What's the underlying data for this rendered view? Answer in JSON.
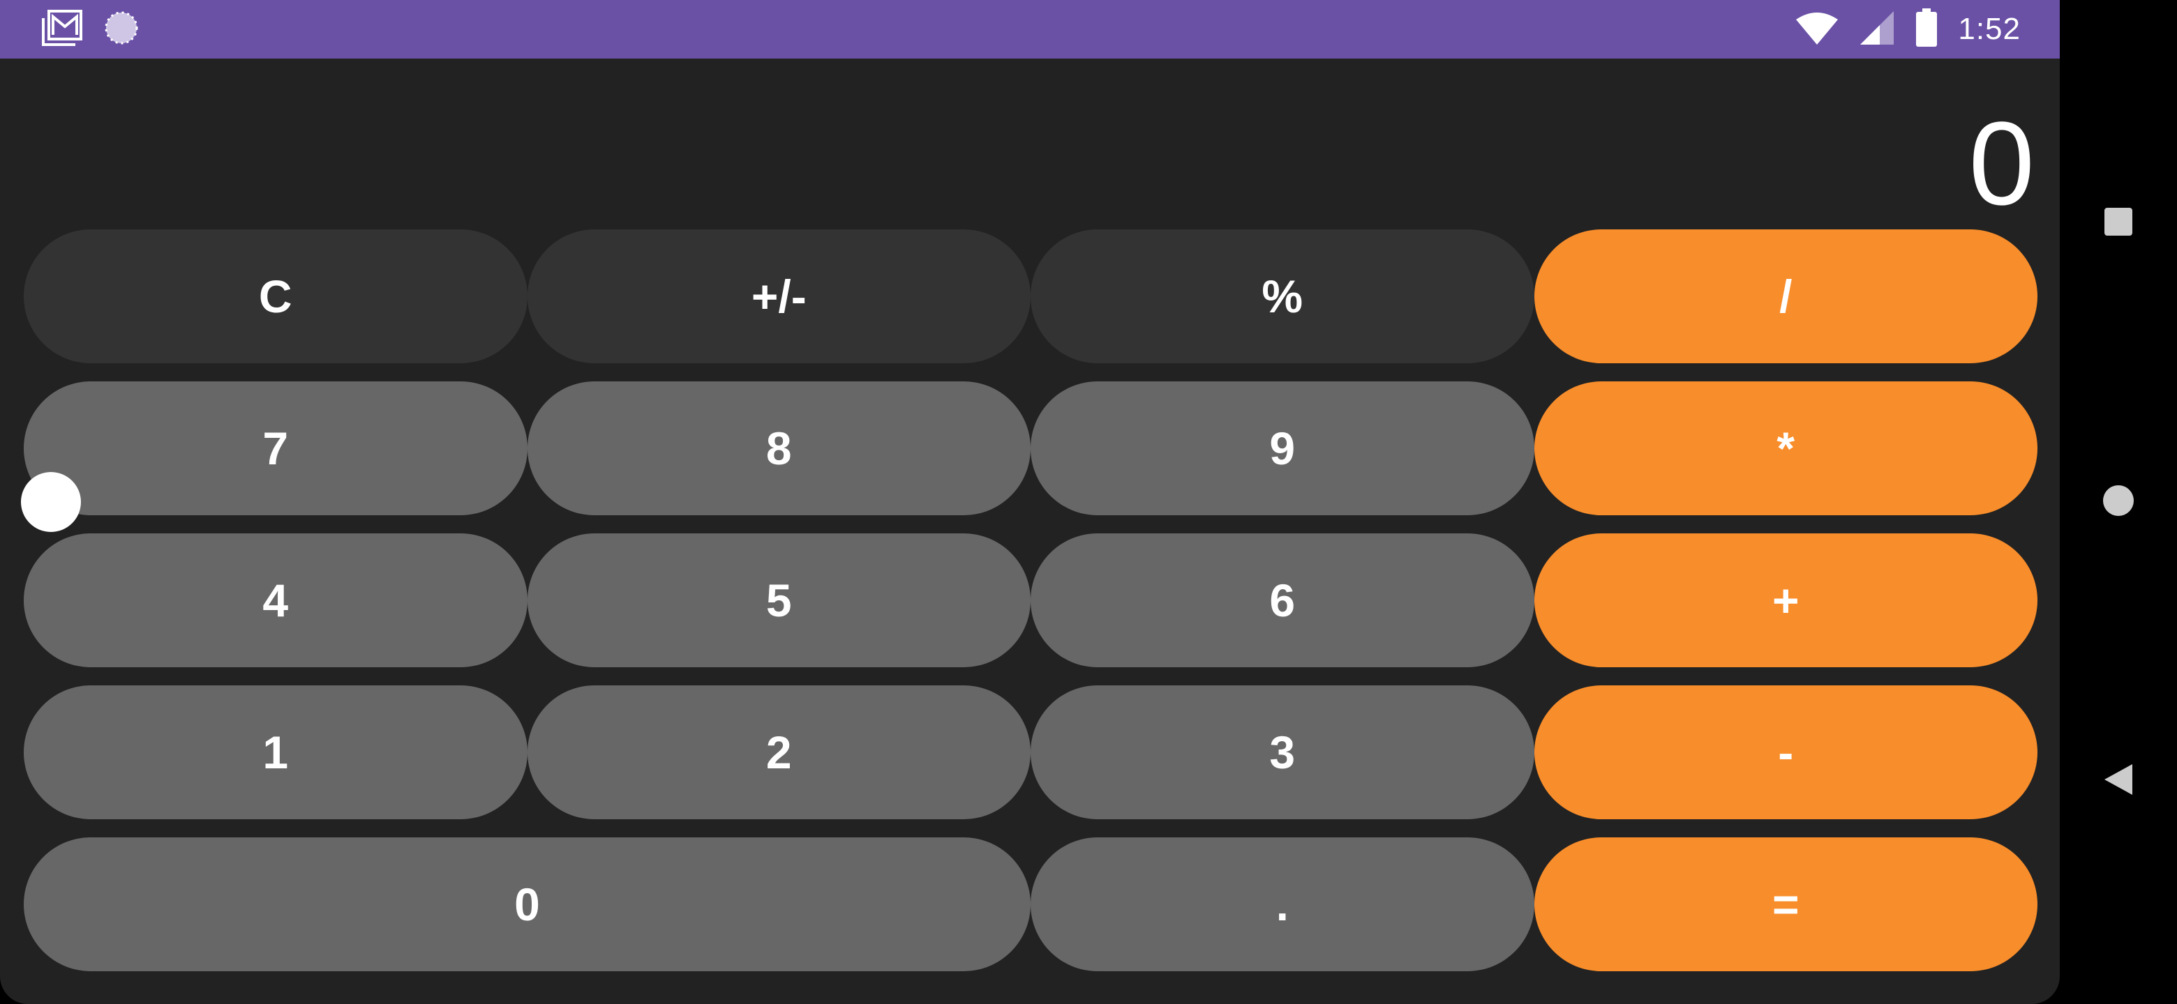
{
  "status_bar": {
    "time": "1:52",
    "color": "#6a51a6",
    "icons": [
      "gallery-icon",
      "loading-icon",
      "wifi-icon",
      "signal-icon",
      "battery-icon"
    ]
  },
  "display": {
    "value": "0"
  },
  "keypad": {
    "rows": [
      [
        {
          "label": "C",
          "kind": "func"
        },
        {
          "label": "+/-",
          "kind": "func"
        },
        {
          "label": "%",
          "kind": "func"
        },
        {
          "label": "/",
          "kind": "op"
        }
      ],
      [
        {
          "label": "7",
          "kind": "num"
        },
        {
          "label": "8",
          "kind": "num"
        },
        {
          "label": "9",
          "kind": "num"
        },
        {
          "label": "*",
          "kind": "op"
        }
      ],
      [
        {
          "label": "4",
          "kind": "num"
        },
        {
          "label": "5",
          "kind": "num"
        },
        {
          "label": "6",
          "kind": "num"
        },
        {
          "label": "+",
          "kind": "op"
        }
      ],
      [
        {
          "label": "1",
          "kind": "num"
        },
        {
          "label": "2",
          "kind": "num"
        },
        {
          "label": "3",
          "kind": "num"
        },
        {
          "label": "-",
          "kind": "op"
        }
      ],
      [
        {
          "label": "0",
          "kind": "num"
        },
        {
          "label": ".",
          "kind": "num"
        },
        {
          "label": "=",
          "kind": "op"
        }
      ]
    ],
    "colors": {
      "function": "#333333",
      "number": "#676767",
      "operator": "#f88d2b",
      "background": "#222222"
    }
  },
  "nav_bar": {
    "buttons": [
      "recents-icon",
      "home-icon",
      "back-icon"
    ]
  }
}
